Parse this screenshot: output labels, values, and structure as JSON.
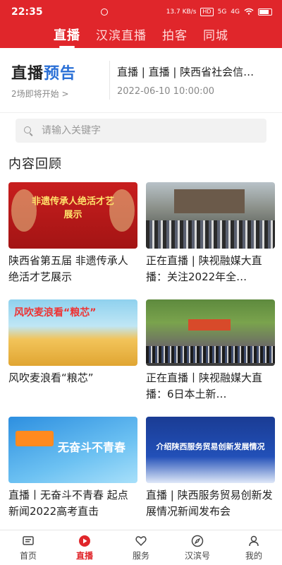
{
  "status": {
    "time": "22:35",
    "speed": "13.7 KB/s",
    "net1": "HD",
    "net2": "5G",
    "net3": "4G"
  },
  "top_tabs": [
    {
      "label": "直播",
      "active": true
    },
    {
      "label": "汉滨直播",
      "active": false
    },
    {
      "label": "拍客",
      "active": false
    },
    {
      "label": "同城",
      "active": false
    }
  ],
  "preview": {
    "title_main": "直播",
    "title_accent": "预告",
    "subtitle": "2场即将开始",
    "chevron": ">",
    "live_text": "直播 | 直播 | 陕西省社会信…",
    "time": "2022-06-10 10:00:00"
  },
  "search": {
    "placeholder": "请输入关键字",
    "value": ""
  },
  "section_title": "内容回顾",
  "cards": [
    {
      "title": "陕西省第五届 非遗传承人绝活才艺展示",
      "thumb_text": "非遗传承人绝活才艺展示"
    },
    {
      "title": "正在直播 | 陕视融媒大直播：关注2022年全…"
    },
    {
      "title": "风吹麦浪看“粮芯”",
      "thumb_text": "风吹麦浪看“粮芯”"
    },
    {
      "title": "正在直播丨陕视融媒大直播：6日本土新…"
    },
    {
      "title": "直播丨无奋斗不青春 起点新闻2022高考直击",
      "thumb_text": "无奋斗不青春"
    },
    {
      "title": "直播 | 陕西服务贸易创新发展情况新闻发布会",
      "thumb_text": "介绍陕西服务贸易创新发展情况"
    }
  ],
  "bottom_nav": [
    {
      "label": "首页",
      "icon": "home-icon",
      "active": false
    },
    {
      "label": "直播",
      "icon": "play-icon",
      "active": true
    },
    {
      "label": "服务",
      "icon": "service-icon",
      "active": false
    },
    {
      "label": "汉滨号",
      "icon": "compass-icon",
      "active": false
    },
    {
      "label": "我的",
      "icon": "person-icon",
      "active": false
    }
  ],
  "colors": {
    "brand_red": "#e0262b",
    "accent_blue": "#2a6fd6"
  }
}
